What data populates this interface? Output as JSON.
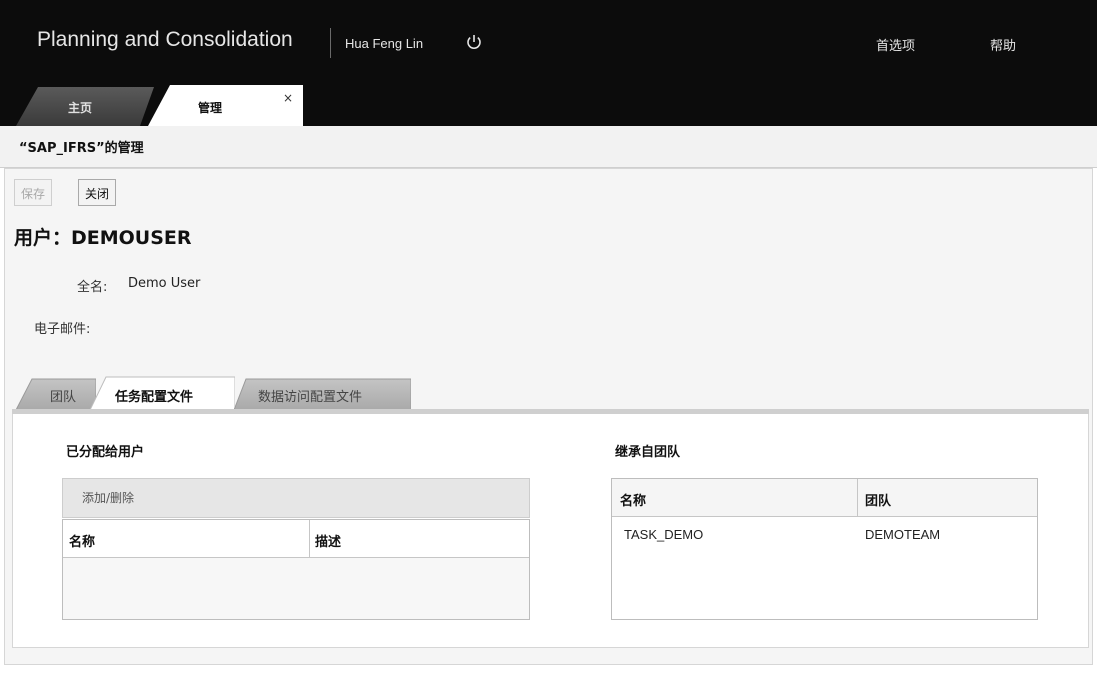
{
  "header": {
    "app_title": "Planning and Consolidation",
    "user_name": "Hua Feng Lin",
    "preferences": "首选项",
    "help": "帮助"
  },
  "tabs": [
    {
      "label": "主页",
      "active": false
    },
    {
      "label": "管理",
      "active": true
    }
  ],
  "tab_close": "×",
  "page_title": "“SAP_IFRS”的管理",
  "toolbar": {
    "save": "保存",
    "close": "关闭"
  },
  "user_heading": "用户：DEMOUSER",
  "fields": {
    "full_name_label": "全名:",
    "full_name_value": "Demo User",
    "email_label": "电子邮件:"
  },
  "subtabs": [
    {
      "label": "团队",
      "active": false
    },
    {
      "label": "任务配置文件",
      "active": true
    },
    {
      "label": "数据访问配置文件",
      "active": false
    }
  ],
  "assigned": {
    "title": "已分配给用户",
    "add_remove": "添加/删除",
    "columns": [
      "名称",
      "描述"
    ],
    "rows": []
  },
  "inherited": {
    "title": "继承自团队",
    "columns": [
      "名称",
      "团队"
    ],
    "rows": [
      {
        "name": "TASK_DEMO",
        "team": "DEMOTEAM"
      }
    ]
  }
}
